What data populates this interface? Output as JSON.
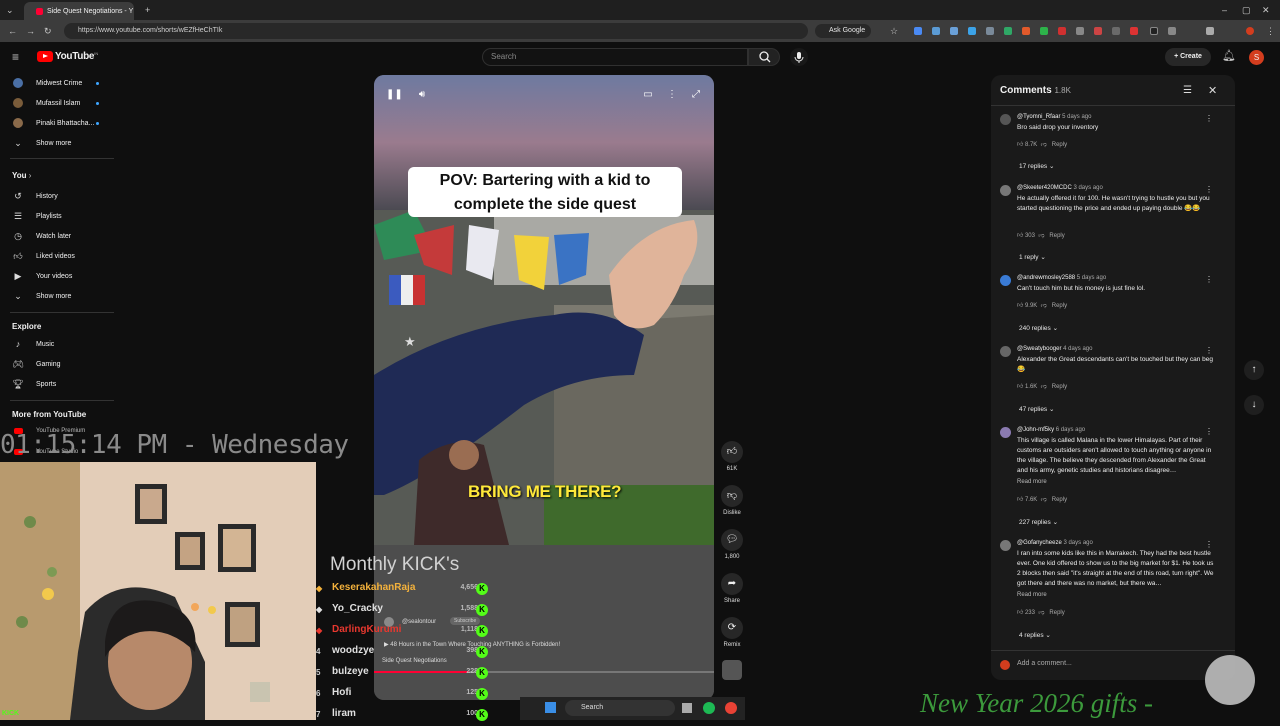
{
  "browser": {
    "tab_title": "Side Quest Negotiations - Y",
    "url": "https://www.youtube.com/shorts/wEZfHeChTIk",
    "ask_google": "Ask Google"
  },
  "youtube": {
    "logo_text": "YouTube",
    "logo_country": "IN",
    "search_placeholder": "Search",
    "create_label": "Create",
    "avatar_letter": "S"
  },
  "sidebar": {
    "subscriptions": [
      {
        "label": "Midwest Crime",
        "color": "#4a6fa5"
      },
      {
        "label": "Mufassil Islam",
        "color": "#7a5c3a"
      },
      {
        "label": "Pinaki Bhattacha...",
        "color": "#8a6a4a"
      }
    ],
    "show_more_1": "Show more",
    "you_heading": "You",
    "you_items": [
      {
        "label": "History",
        "icon": "history-icon"
      },
      {
        "label": "Playlists",
        "icon": "playlists-icon"
      },
      {
        "label": "Watch later",
        "icon": "watch-later-icon"
      },
      {
        "label": "Liked videos",
        "icon": "liked-videos-icon"
      },
      {
        "label": "Your videos",
        "icon": "your-videos-icon"
      }
    ],
    "show_more_2": "Show more",
    "explore_heading": "Explore",
    "explore_items": [
      {
        "label": "Music",
        "icon": "music-icon"
      },
      {
        "label": "Gaming",
        "icon": "gaming-icon"
      },
      {
        "label": "Sports",
        "icon": "sports-icon"
      }
    ],
    "more_heading": "More from YouTube",
    "more_items": [
      "YouTube Premium",
      "YouTube Studio"
    ]
  },
  "overlay": {
    "clock": "01:15:14 PM - Wednesday",
    "kick_title": "Monthly KICK's",
    "promo": "New Year 2026 gifts -",
    "cam_tag": "KICK"
  },
  "leaderboard": [
    {
      "rank": "",
      "name": "KeserakahanRaja",
      "score": "4,656",
      "color": "#f4b23c"
    },
    {
      "rank": "",
      "name": "Yo_Cracky",
      "score": "1,588",
      "color": "#e0e0e0"
    },
    {
      "rank": "",
      "name": "DarlingKurumi",
      "score": "1,118",
      "color": "#e8382f"
    },
    {
      "rank": "4",
      "name": "woodzye",
      "score": "398",
      "color": "#e0e0e0"
    },
    {
      "rank": "5",
      "name": "bulzeye",
      "score": "228",
      "color": "#e0e0e0"
    },
    {
      "rank": "6",
      "name": "Hofi",
      "score": "125",
      "color": "#e0e0e0"
    },
    {
      "rank": "7",
      "name": "liram",
      "score": "100",
      "color": "#e0e0e0"
    }
  ],
  "video": {
    "title_card": "POV: Bartering with a kid to complete the side quest",
    "caption": "BRING ME THERE?",
    "channel": "@sealontour",
    "subscribe": "Subscribe",
    "related": "48 Hours in the Town Where Touching ANYTHING is Forbidden!",
    "short_title": "Side Quest Negotiations",
    "progress": 0.28
  },
  "actions": {
    "likes": "61K",
    "dislike": "Dislike",
    "comments": "1,800",
    "share": "Share",
    "remix": "Remix"
  },
  "comments": {
    "heading": "Comments",
    "count": "1.8K",
    "add_placeholder": "Add a comment...",
    "items": [
      {
        "handle": "@Tyomni_Rfaar",
        "time": "5 days ago",
        "text": "Bro said drop your inventory",
        "likes": "8.7K",
        "replies": "17 replies",
        "color": "#555"
      },
      {
        "handle": "@Skeeter420MCDC",
        "time": "3 days ago",
        "text": "He actually offered it for 100. He wasn't trying to hustle you but you started questioning the price and ended up paying double 😂😂",
        "likes": "303",
        "replies": "1 reply",
        "color": "#777"
      },
      {
        "handle": "@andrewmosley2588",
        "time": "5 days ago",
        "text": "Can't touch him but his money is just fine lol.",
        "likes": "9.9K",
        "replies": "240 replies",
        "color": "#3a7bd5"
      },
      {
        "handle": "@Sweatybooger",
        "time": "4 days ago",
        "text": "Alexander the Great descendants can't be touched but they can beg😂",
        "likes": "1.6K",
        "replies": "47 replies",
        "color": "#666"
      },
      {
        "handle": "@John-mf5ky",
        "time": "6 days ago",
        "text": "This village is called Malana in the lower Himalayas. Part of their customs are outsiders aren't allowed to touch anything or anyone in the village. The believe they descended from Alexander the Great and his army, genetic studies and historians disagree…",
        "read_more": "Read more",
        "likes": "7.6K",
        "replies": "227 replies",
        "color": "#8a7ab0"
      },
      {
        "handle": "@Gofanycheeze",
        "time": "3 days ago",
        "text": "I ran into some kids like this in Marrakech. They had the best hustle ever. One kid offered to show us to the big market for $1. He took us 2 blocks then said \"it's straight at the end of this road, turn right\". We got there and there was no market, but there wa…",
        "read_more": "Read more",
        "likes": "233",
        "replies": "4 replies",
        "color": "#777"
      }
    ],
    "reply_label": "Reply"
  },
  "taskbar": {
    "search": "Search"
  }
}
